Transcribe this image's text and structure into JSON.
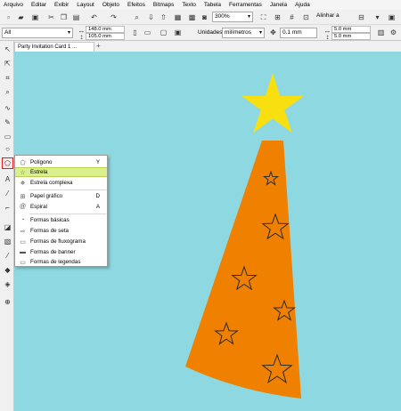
{
  "menu": [
    "Arquivo",
    "Editar",
    "Exibir",
    "Layout",
    "Objeto",
    "Efeitos",
    "Bitmaps",
    "Texto",
    "Tabela",
    "Ferramentas",
    "Janela",
    "Ajuda"
  ],
  "toolbar": {
    "zoom": "300%",
    "align": "Alinhar a"
  },
  "property_bar": {
    "selection": "All",
    "width": "148.0 mm",
    "height": "105.0 mm",
    "units_label": "Unidades:",
    "units": "milímetros",
    "nudge": "0.1 mm",
    "dup_x": "5.0 mm",
    "dup_y": "5.0 mm"
  },
  "document_tab": "Party Invitation Card 1 ...",
  "tab_add": "+",
  "flyout": {
    "items": [
      {
        "label": "Polígono",
        "key": "Y",
        "icon": "polygon-icon"
      },
      {
        "label": "Estrela",
        "key": "",
        "icon": "star-icon"
      },
      {
        "label": "Estrela complexa",
        "key": "",
        "icon": "complex-star-icon"
      },
      {
        "label": "Papel gráfico",
        "key": "D",
        "icon": "graph-paper-icon"
      },
      {
        "label": "Espiral",
        "key": "A",
        "icon": "spiral-icon"
      },
      {
        "label": "Formas básicas",
        "key": "",
        "icon": "basic-shapes-icon"
      },
      {
        "label": "Formas de seta",
        "key": "",
        "icon": "arrow-shapes-icon"
      },
      {
        "label": "Formas de fluxograma",
        "key": "",
        "icon": "flowchart-shapes-icon"
      },
      {
        "label": "Formas de banner",
        "key": "",
        "icon": "banner-shapes-icon"
      },
      {
        "label": "Formas de legendas",
        "key": "",
        "icon": "callout-shapes-icon"
      }
    ]
  },
  "colors": {
    "canvas": "#8ed8e1",
    "hat": "#f08000",
    "top_star": "#f8e010",
    "highlight": "#d9f08c"
  }
}
